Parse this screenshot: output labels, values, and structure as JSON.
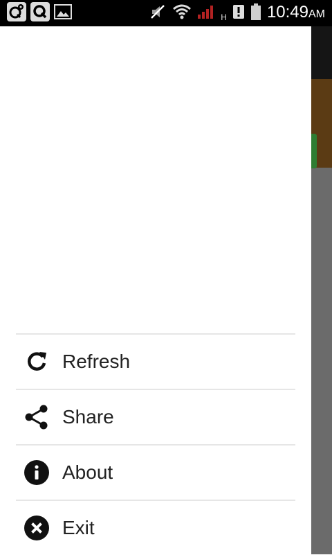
{
  "status_bar": {
    "left_icons": [
      "app-settings-icon",
      "app-q-icon",
      "image-icon"
    ],
    "right_icons": [
      "mute-icon",
      "wifi-icon",
      "signal-icon",
      "network-type-icon",
      "alert-icon",
      "battery-icon"
    ],
    "network_type": "H",
    "time": "10:49",
    "ampm": "AM"
  },
  "drawer": {
    "menu": [
      {
        "label": "Refresh",
        "icon": "refresh-icon"
      },
      {
        "label": "Share",
        "icon": "share-icon"
      },
      {
        "label": "About",
        "icon": "info-icon"
      },
      {
        "label": "Exit",
        "icon": "close-circle-icon"
      }
    ]
  },
  "colors": {
    "status_bar": "#000000",
    "signal": "#b22222",
    "app_header": "#151515",
    "app_banner": "#5b3b14",
    "app_accent": "#2e7d32",
    "scrim": "#6b6b6b"
  }
}
